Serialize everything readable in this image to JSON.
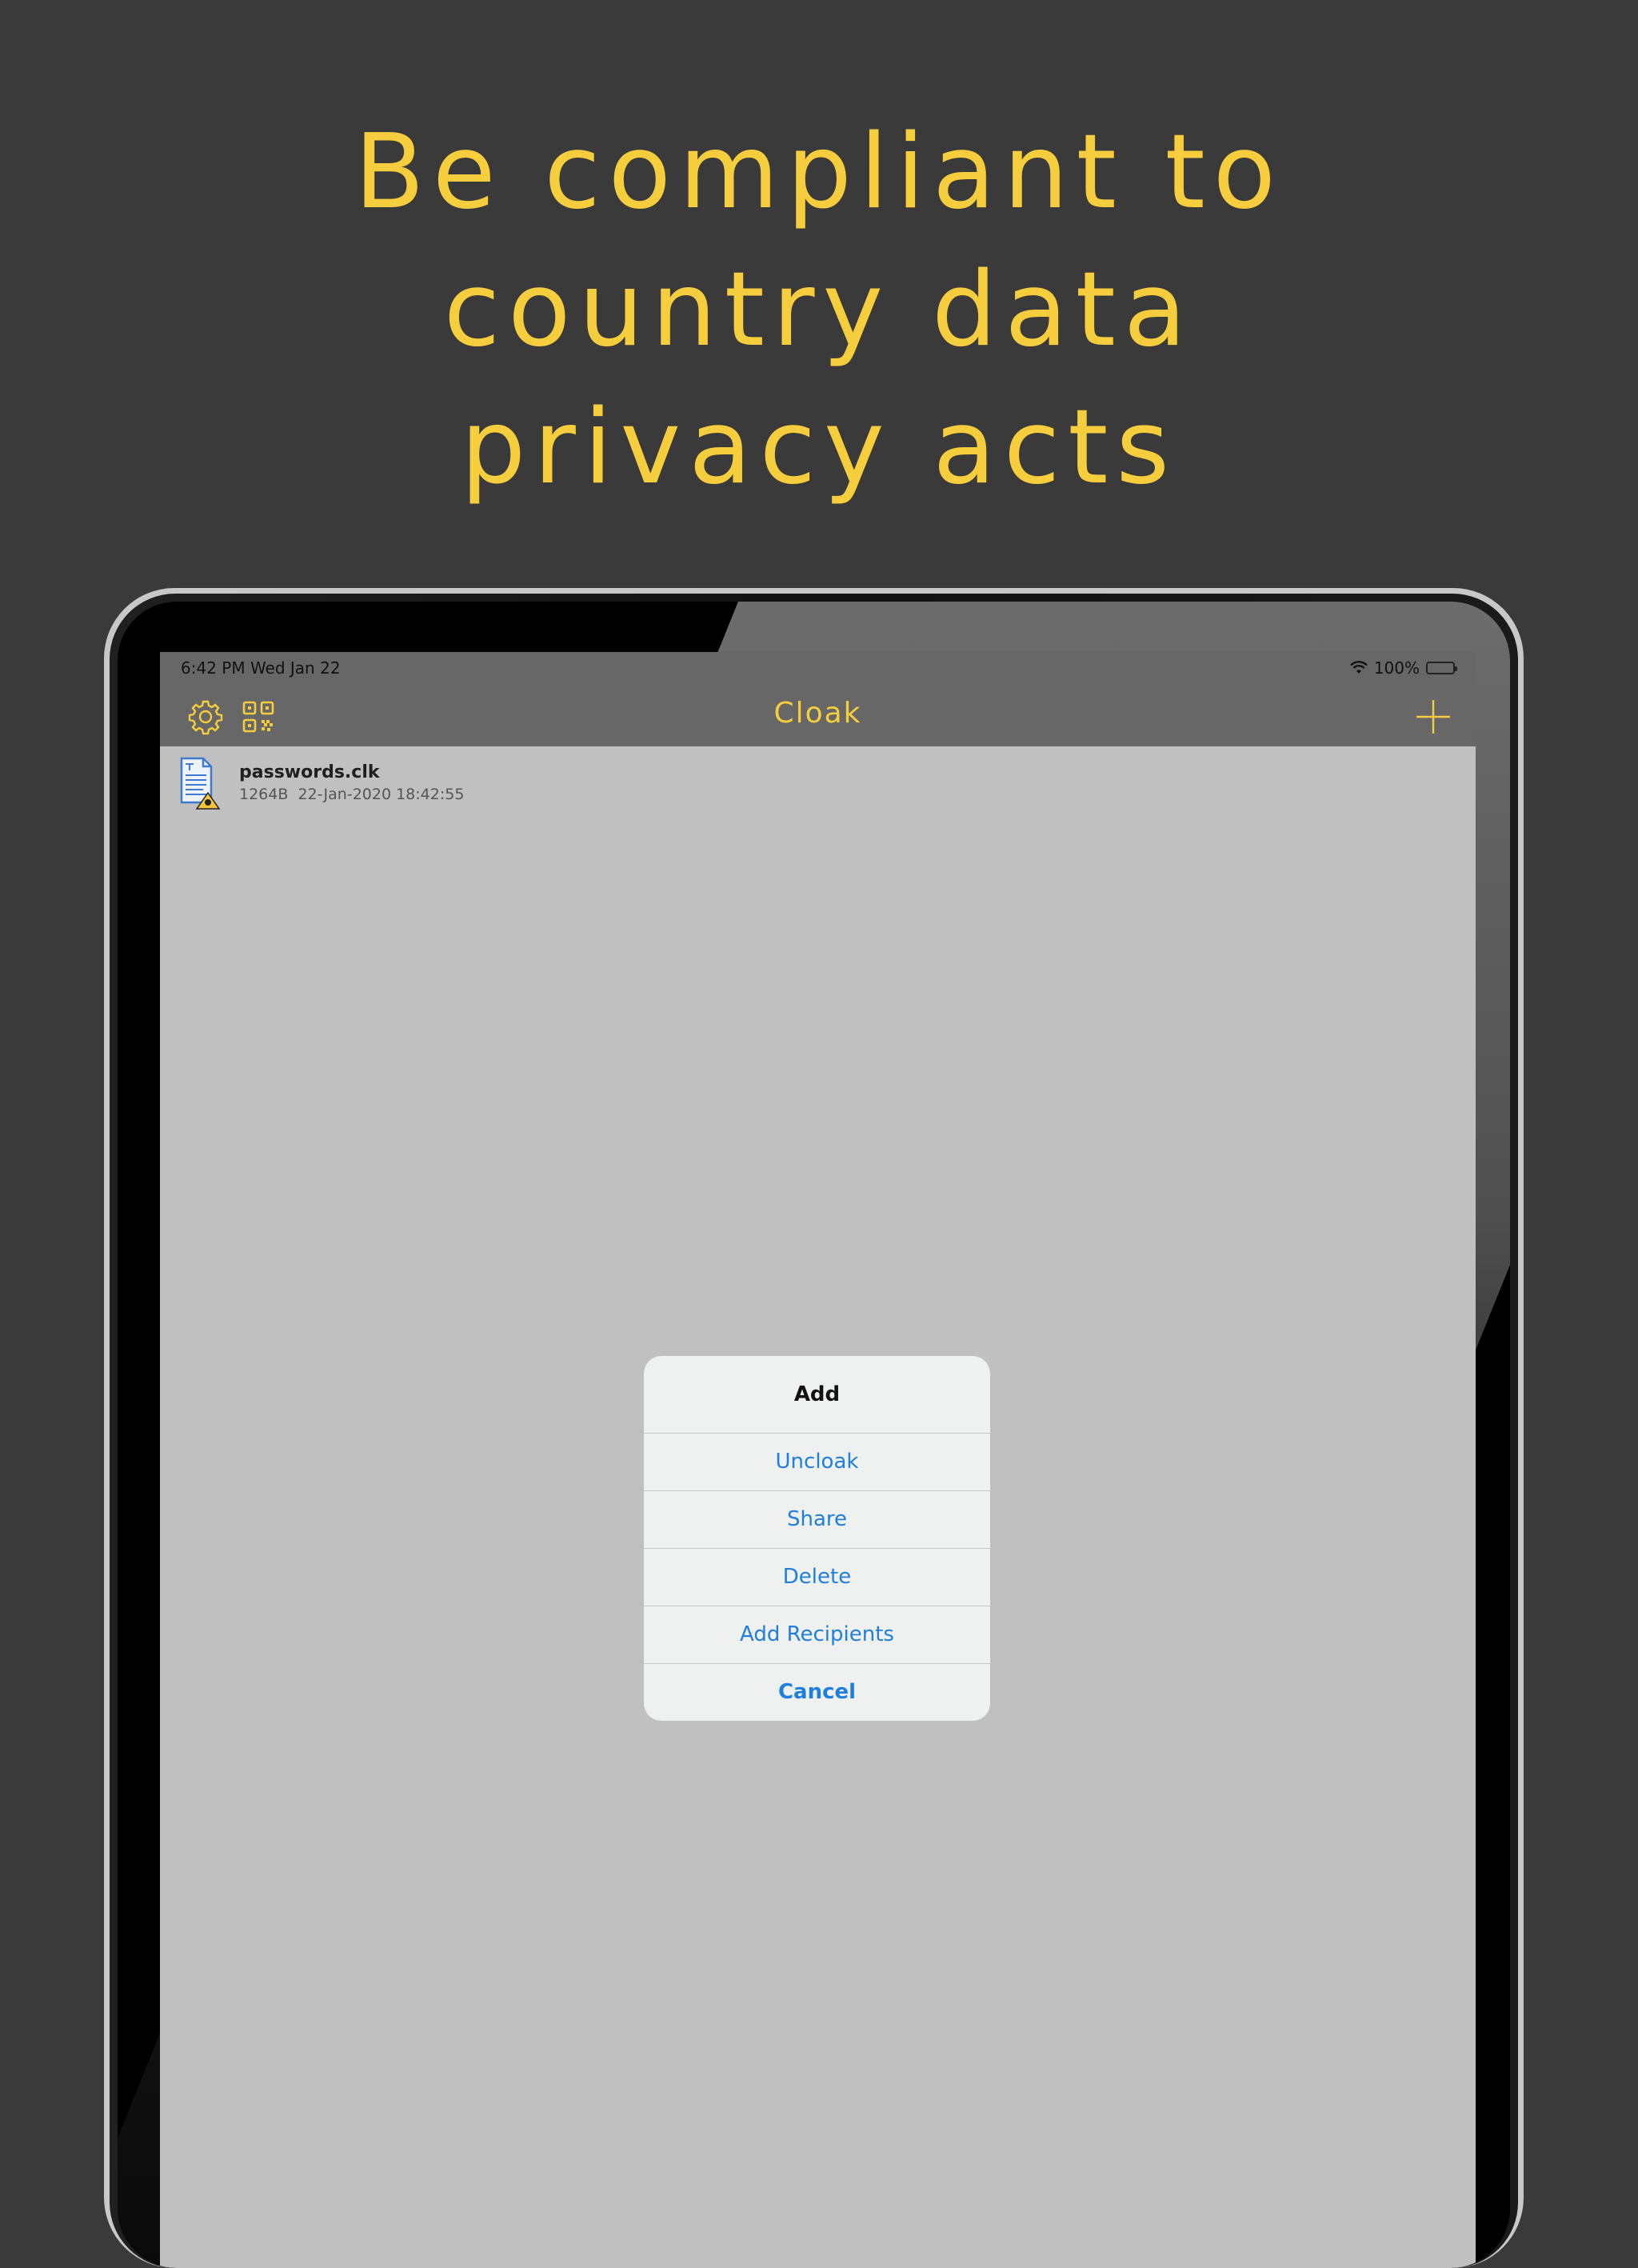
{
  "headline": {
    "line1": "Be compliant to",
    "line2": "country data",
    "line3": "privacy acts"
  },
  "status_bar": {
    "time": "6:42 PM   Wed Jan 22",
    "battery": "100%",
    "wifi_icon": "wifi-icon",
    "battery_icon": "battery-icon"
  },
  "nav": {
    "title": "Cloak",
    "settings_icon": "gear-icon",
    "qr_icon": "qr-code-icon",
    "add_icon": "plus-icon"
  },
  "files": [
    {
      "name": "passwords.clk",
      "meta": "1264B  22-Jan-2020 18:42:55",
      "icon": "encrypted-document-icon"
    }
  ],
  "alert": {
    "title": "Add",
    "buttons": [
      "Uncloak",
      "Share",
      "Delete",
      "Add Recipients",
      "Cancel"
    ]
  },
  "colors": {
    "accent": "#f6cd3d",
    "background": "#3a3a3a",
    "link": "#1f7fe0"
  }
}
